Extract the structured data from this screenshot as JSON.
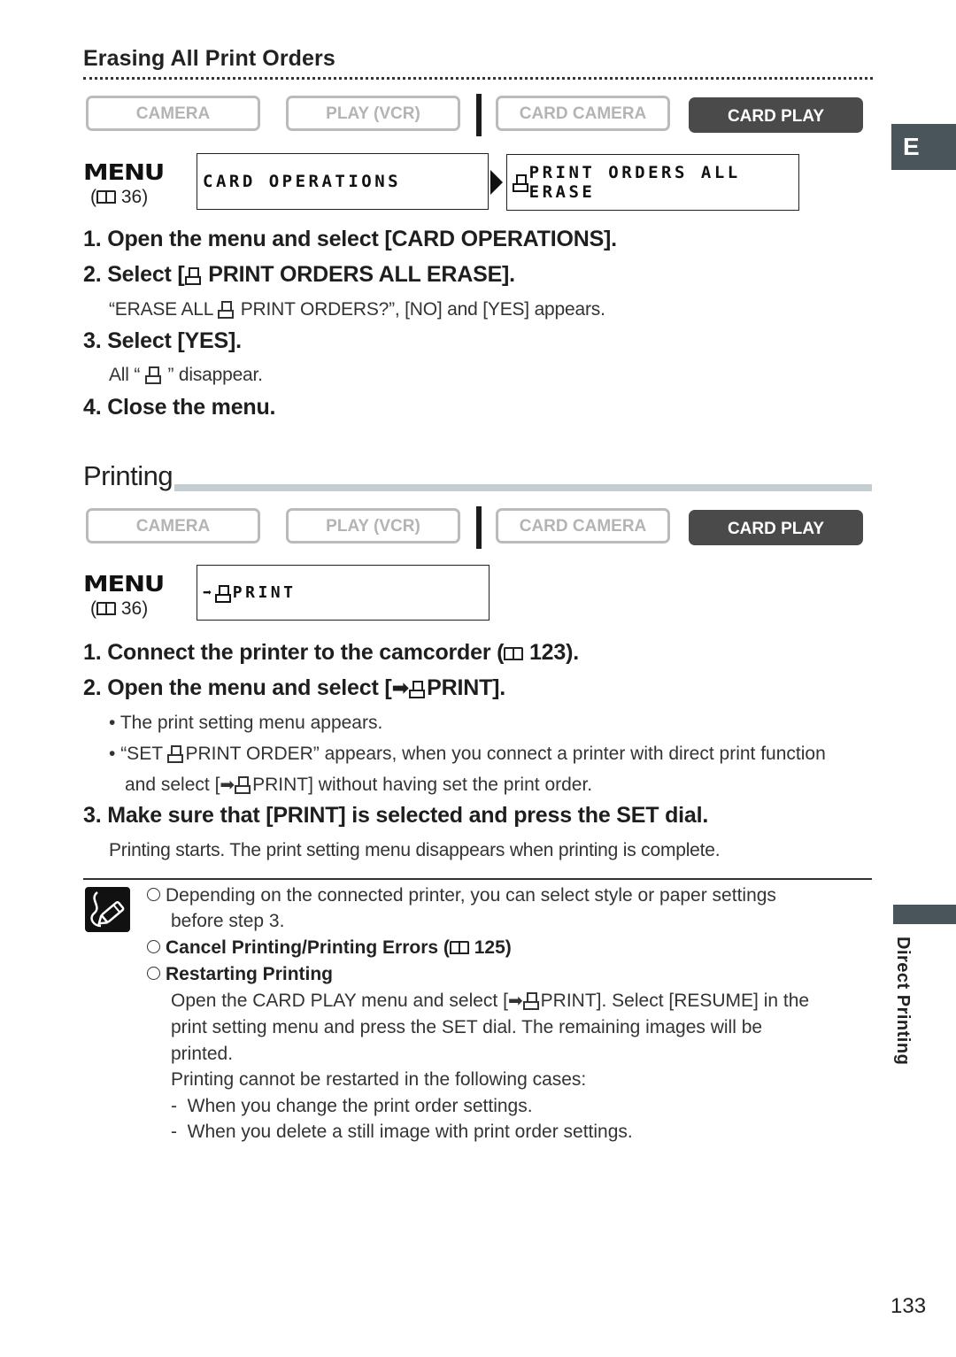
{
  "side_tab": {
    "language": "E",
    "section": "Direct Printing"
  },
  "page_number": "133",
  "erase_section": {
    "heading": "Erasing All Print Orders",
    "modes": [
      "CAMERA",
      "PLAY (VCR)",
      "CARD CAMERA",
      "CARD PLAY"
    ],
    "active_mode": "CARD PLAY",
    "menu_label": "MENU",
    "menu_ref": "36",
    "lcd_menu": "CARD OPERATIONS",
    "lcd_submenu": "PRINT ORDERS ALL ERASE",
    "steps": [
      {
        "num": "1.",
        "text": "Open the menu and select [CARD OPERATIONS]."
      },
      {
        "num": "2.",
        "pre": "Select [",
        "text": "PRINT ORDERS ALL ERASE].",
        "sub_pre": "“ERASE ALL ",
        "sub_post": "PRINT ORDERS?”, [NO] and [YES] appears."
      },
      {
        "num": "3.",
        "text": "Select [YES].",
        "sub_pre": "All “",
        "sub_post": "” disappear."
      },
      {
        "num": "4.",
        "text": "Close the menu."
      }
    ]
  },
  "print_section": {
    "heading": "Printing",
    "modes": [
      "CAMERA",
      "PLAY (VCR)",
      "CARD CAMERA",
      "CARD PLAY"
    ],
    "active_mode": "CARD PLAY",
    "menu_label": "MENU",
    "menu_ref": "36",
    "lcd_menu": "PRINT",
    "steps": [
      {
        "num": "1.",
        "pre": "Connect the printer to the camcorder (",
        "ref": "123",
        "post": ")."
      },
      {
        "num": "2.",
        "pre": "Open the menu and select [",
        "post": "PRINT]."
      },
      {
        "num": "3.",
        "text": "Make sure that [PRINT] is selected and press the SET dial."
      }
    ],
    "step2_bullets": [
      "The print setting menu appears.",
      {
        "pre": "“SET ",
        "mid": "PRINT ORDER” appears, when you connect a printer with direct print function",
        "line2_pre": "and select [",
        "line2_post": "PRINT] without having set the print order."
      }
    ],
    "step3_sub": "Printing starts. The print setting menu disappears when printing is complete."
  },
  "notes": {
    "icon": "pencil-note-icon",
    "items": [
      {
        "text": "Depending on the connected printer, you can select style or paper settings",
        "text2": "before step 3."
      },
      {
        "title": "Cancel Printing/Printing Errors (",
        "ref": "125",
        "post": ")"
      },
      {
        "title": "Restarting Printing"
      }
    ],
    "restart_body": {
      "l1_pre": "Open the CARD PLAY menu and select [",
      "l1_post": "PRINT]. Select [RESUME] in the",
      "l2": "print setting menu and press the SET dial. The remaining images will be",
      "l3": "printed.",
      "l4": "Printing cannot be restarted in the following cases:",
      "cases": [
        "When you change the print order settings.",
        "When you delete a still image with print order settings."
      ]
    }
  }
}
